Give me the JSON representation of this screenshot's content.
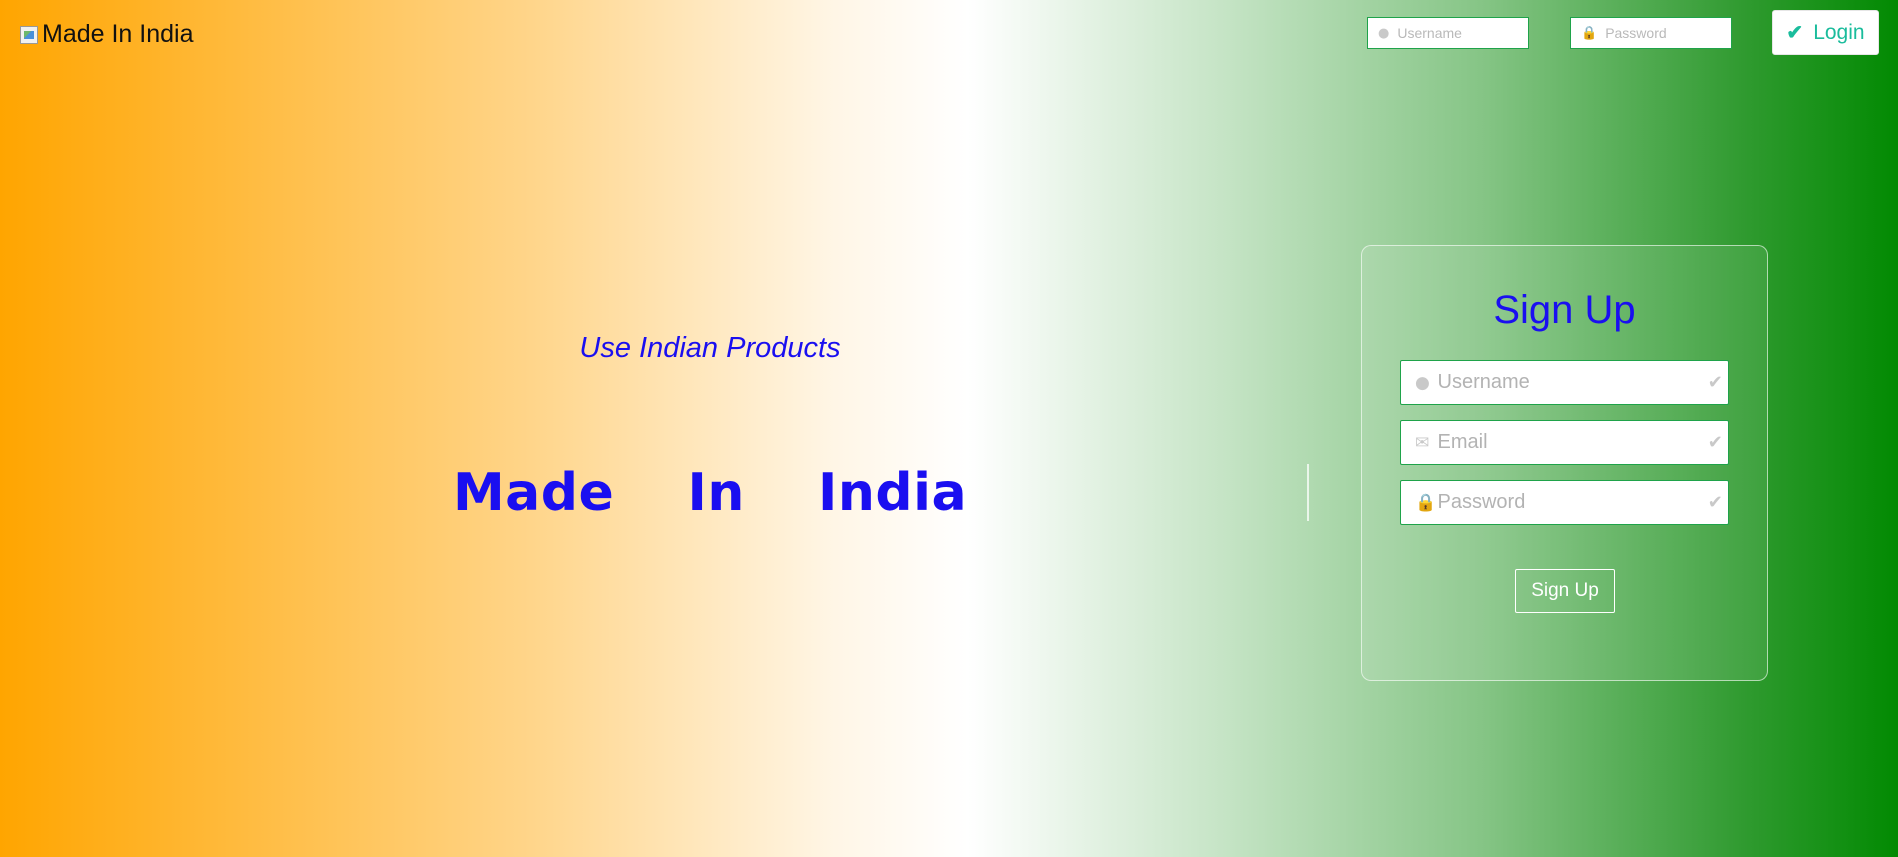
{
  "header": {
    "logo_alt": "Made In India",
    "username_placeholder": "Username",
    "password_placeholder": "Password",
    "login_label": "Login"
  },
  "hero": {
    "tagline": "Use Indian Products",
    "title": "Made  In  India"
  },
  "signup": {
    "title": "Sign Up",
    "username_placeholder": "Username",
    "email_placeholder": "Email",
    "password_placeholder": "Password",
    "button_label": "Sign Up"
  },
  "icons": {
    "user": "user-icon",
    "lock": "lock-icon",
    "envelope": "envelope-icon",
    "check": "check-icon"
  },
  "colors": {
    "saffron": "#ffa500",
    "green": "#028a02",
    "heading_blue": "#1a0ff0",
    "login_teal": "#1abc9c"
  }
}
